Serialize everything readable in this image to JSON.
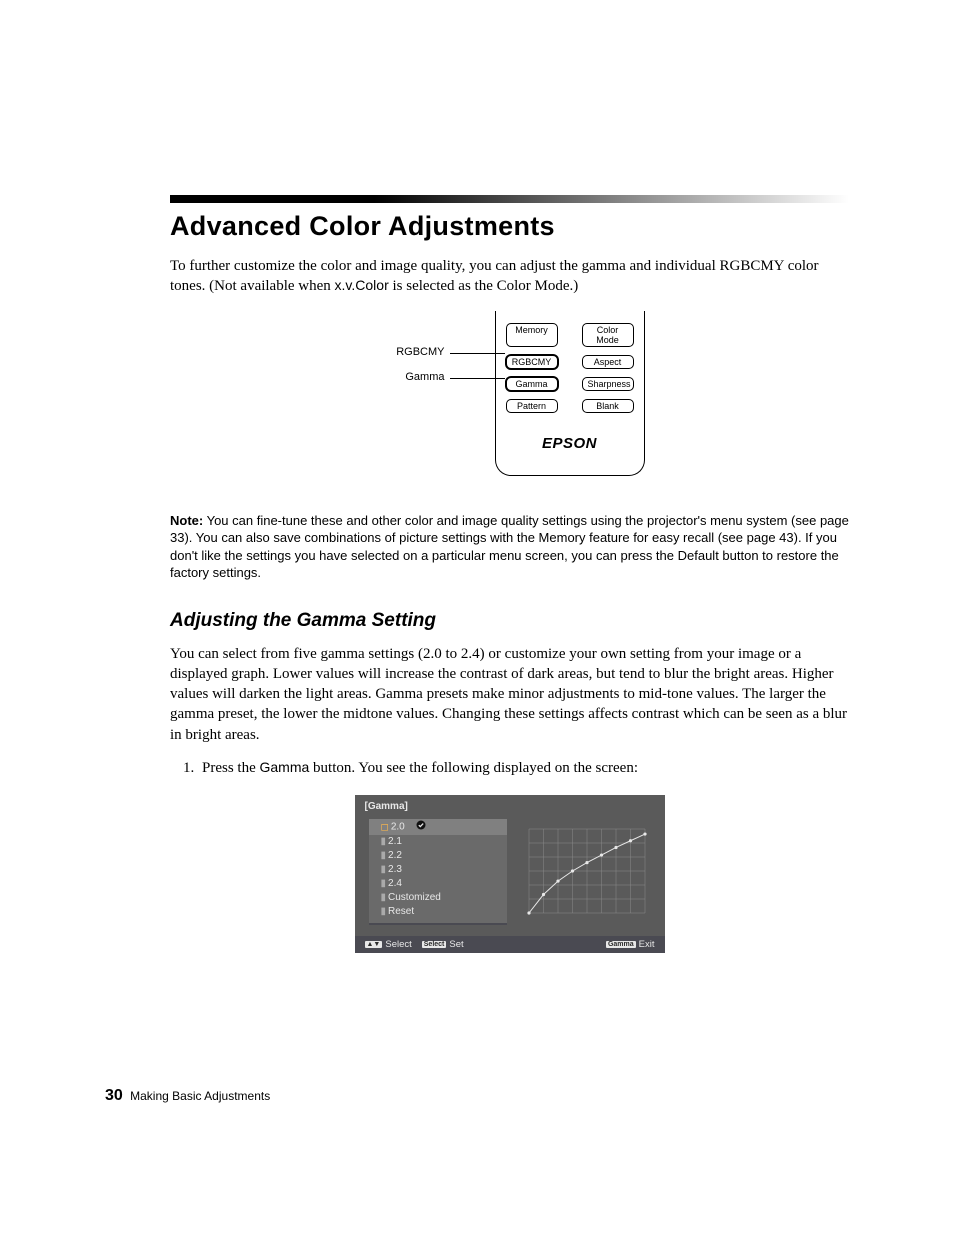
{
  "title": "Advanced Color Adjustments",
  "intro_a": "To further customize the color and image quality, you can adjust the gamma and individual RGBCMY color tones. (Not available when ",
  "intro_code": "x.v.Color",
  "intro_b": " is selected as the Color Mode.)",
  "remote": {
    "callout_rgbcmy": "RGBCMY",
    "callout_gamma": "Gamma",
    "buttons": {
      "r1c1": "Memory",
      "r1c2": "Color Mode",
      "r2c1": "RGBCMY",
      "r2c2": "Aspect",
      "r3c1": "Gamma",
      "r3c2": "Sharpness",
      "r4c1": "Pattern",
      "r4c2": "Blank"
    },
    "logo": "EPSON"
  },
  "note_label": "Note:",
  "note_text": " You can fine-tune these and other color and image quality settings using the projector's menu system (see page 33). You can also save combinations of picture settings with the Memory feature for easy recall (see page 43). If you don't like the settings you have selected on a particular menu screen, you can press the Default button to restore the factory settings.",
  "subhead": "Adjusting the Gamma Setting",
  "gamma_para": "You can select from five gamma settings (2.0 to 2.4) or customize your own setting from your image or a displayed graph. Lower values will increase the contrast of dark areas, but tend to blur the bright areas. Higher values will darken the light areas. Gamma presets make minor adjustments to mid-tone values. The larger the gamma preset, the lower the midtone values. Changing these settings affects contrast which can be seen as a blur in bright areas.",
  "step1_a": "Press the ",
  "step1_btn": "Gamma",
  "step1_b": " button. You see the following displayed on the screen:",
  "osd": {
    "header": "[Gamma]",
    "items": [
      "2.0",
      "2.1",
      "2.2",
      "2.3",
      "2.4",
      "Customized",
      "Reset"
    ],
    "selected_index": 0,
    "footer": {
      "select_icon": "▲▼",
      "select": "Select",
      "set_tag": "Select",
      "set": "Set",
      "exit_tag": "Gamma",
      "exit": "Exit"
    }
  },
  "chart_data": {
    "type": "line",
    "title": "",
    "xlabel": "",
    "ylabel": "",
    "x": [
      0,
      1,
      2,
      3,
      4,
      5,
      6,
      7,
      8
    ],
    "values": [
      0.0,
      0.22,
      0.38,
      0.5,
      0.6,
      0.69,
      0.78,
      0.86,
      0.94
    ],
    "xlim": [
      0,
      8
    ],
    "ylim": [
      0,
      1
    ]
  },
  "footer": {
    "page_number": "30",
    "section": "Making Basic Adjustments"
  }
}
